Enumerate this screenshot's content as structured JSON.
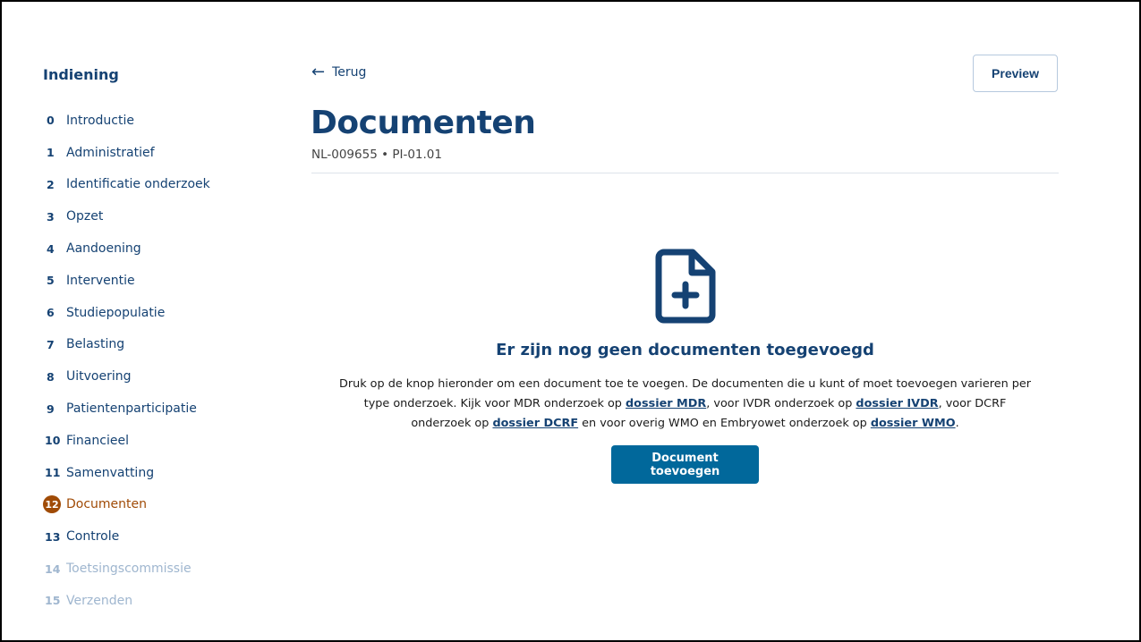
{
  "sidebar": {
    "title": "Indiening",
    "steps": [
      {
        "num": "0",
        "label": "Introductie"
      },
      {
        "num": "1",
        "label": "Administratief"
      },
      {
        "num": "2",
        "label": "Identificatie onderzoek"
      },
      {
        "num": "3",
        "label": "Opzet"
      },
      {
        "num": "4",
        "label": "Aandoening"
      },
      {
        "num": "5",
        "label": "Interventie"
      },
      {
        "num": "6",
        "label": "Studiepopulatie"
      },
      {
        "num": "7",
        "label": "Belasting"
      },
      {
        "num": "8",
        "label": "Uitvoering"
      },
      {
        "num": "9",
        "label": "Patientenparticipatie"
      },
      {
        "num": "10",
        "label": "Financieel"
      },
      {
        "num": "11",
        "label": "Samenvatting"
      },
      {
        "num": "12",
        "label": "Documenten"
      },
      {
        "num": "13",
        "label": "Controle"
      },
      {
        "num": "14",
        "label": "Toetsingscommissie"
      },
      {
        "num": "15",
        "label": "Verzenden"
      }
    ]
  },
  "header": {
    "back_label": "Terug",
    "preview_label": "Preview",
    "title": "Documenten",
    "subtitle": "NL-009655 • PI-01.01"
  },
  "empty_state": {
    "icon": "file-plus-icon",
    "title": "Er zijn nog geen documenten toegevoegd",
    "text_1": "Druk op de knop hieronder om een document toe te voegen. De documenten die u kunt of moet toevoegen varieren per type onderzoek. Kijk voor MDR onderzoek op ",
    "link_mdr": "dossier MDR",
    "text_2": ", voor IVDR onderzoek op ",
    "link_ivdr": "dossier IVDR",
    "text_3": ", voor DCRF onderzoek op ",
    "link_dcrf": "dossier DCRF",
    "text_4": " en voor overig WMO en Embryowet onderzoek op ",
    "link_wmo": "dossier WMO",
    "text_5": ".",
    "button_label": "Document toevoegen"
  },
  "colors": {
    "primary": "#154273",
    "button": "#01689b",
    "active_step": "#a04b06",
    "disabled_step": "#9fb6cf"
  }
}
